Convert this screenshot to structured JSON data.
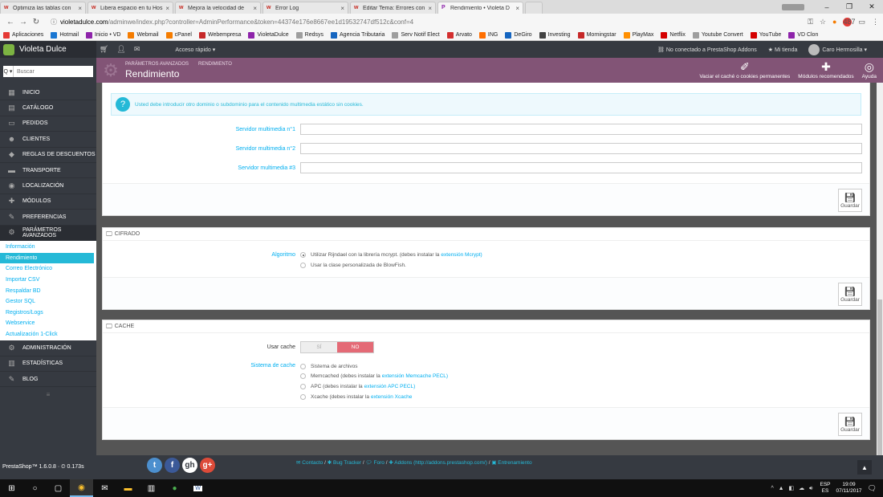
{
  "browser": {
    "tabs": [
      {
        "title": "Optimiza las tablas con",
        "icon": "w",
        "active": false
      },
      {
        "title": "Libera espacio en tu Hos",
        "icon": "w",
        "active": false
      },
      {
        "title": "Mejora la velocidad de",
        "icon": "w",
        "active": false
      },
      {
        "title": "Error Log",
        "icon": "w",
        "active": false
      },
      {
        "title": "Editar Tema: Errores con",
        "icon": "w",
        "active": false
      },
      {
        "title": "Rendimiento • Violeta D",
        "icon": "P",
        "active": true
      }
    ],
    "url_host": "violetadulce.com",
    "url_rest": "/adminwe/index.php?controller=AdminPerformance&token=44374e176e8667ee1d19532747df512c&conf=4",
    "ext_badge": "487",
    "bookmarks": [
      {
        "label": "Aplicaciones",
        "color": "#e53935"
      },
      {
        "label": "Hotmail",
        "color": "#1976d2"
      },
      {
        "label": "Inicio • VD",
        "color": "#8e24aa"
      },
      {
        "label": "Webmail",
        "color": "#f57c00"
      },
      {
        "label": "cPanel",
        "color": "#f57c00"
      },
      {
        "label": "Webempresa",
        "color": "#c62828"
      },
      {
        "label": "VioletaDulce",
        "color": "#8e24aa"
      },
      {
        "label": "Redsys",
        "color": "#9e9e9e"
      },
      {
        "label": "Agencia Tributaria",
        "color": "#1565c0"
      },
      {
        "label": "Serv Notif Elect",
        "color": "#9e9e9e"
      },
      {
        "label": "Arvato",
        "color": "#d32f2f"
      },
      {
        "label": "ING",
        "color": "#ff6f00"
      },
      {
        "label": "DeGiro",
        "color": "#1565c0"
      },
      {
        "label": "Investing",
        "color": "#424242"
      },
      {
        "label": "Morningstar",
        "color": "#c62828"
      },
      {
        "label": "PlayMax",
        "color": "#ff8f00"
      },
      {
        "label": "Netflix",
        "color": "#d50000"
      },
      {
        "label": "Youtube Convert",
        "color": "#9e9e9e"
      },
      {
        "label": "YouTube",
        "color": "#d50000"
      },
      {
        "label": "VD Clon",
        "color": "#8e24aa"
      }
    ]
  },
  "header": {
    "shop_name": "Violeta Dulce",
    "quick_access": "Acceso rápido ▾",
    "not_connected": "No conectado a PrestaShop Addons",
    "my_shop": "Mi tienda",
    "user": "Caro Hermosilla ▾"
  },
  "sidebar": {
    "search_btn": "Q ▾",
    "search_placeholder": "Buscar",
    "items_top": [
      {
        "label": "Inicio",
        "icon": "▦"
      },
      {
        "label": "Catálogo",
        "icon": "▤"
      },
      {
        "label": "Pedidos",
        "icon": "▭"
      },
      {
        "label": "Clientes",
        "icon": "☻"
      },
      {
        "label": "Reglas de descuentos",
        "icon": "◆"
      },
      {
        "label": "Transporte",
        "icon": "▬"
      },
      {
        "label": "Localización",
        "icon": "◉"
      },
      {
        "label": "Módulos",
        "icon": "✚"
      },
      {
        "label": "Preferencias",
        "icon": "✎"
      },
      {
        "label": "Parámetros avanzados",
        "icon": "⚙"
      }
    ],
    "submenu": [
      {
        "label": "Información",
        "active": false
      },
      {
        "label": "Rendimiento",
        "active": true
      },
      {
        "label": "Correo Electrónico",
        "active": false
      },
      {
        "label": "Importar CSV",
        "active": false
      },
      {
        "label": "Respaldar BD",
        "active": false
      },
      {
        "label": "Gestor SQL",
        "active": false
      },
      {
        "label": "Registros/Logs",
        "active": false
      },
      {
        "label": "Webservice",
        "active": false
      },
      {
        "label": "Actualización 1-Click",
        "active": false
      }
    ],
    "items_bottom": [
      {
        "label": "Administración",
        "icon": "⚙"
      },
      {
        "label": "Estadísticas",
        "icon": "▥"
      },
      {
        "label": "Blog",
        "icon": "✎"
      }
    ],
    "collapse": "≡",
    "footer": "PrestaShop™ 1.6.0.8 · ⏲ 0.173s"
  },
  "content_header": {
    "breadcrumb": [
      "Parámetros avanzados",
      "Rendimiento"
    ],
    "title": "Rendimiento",
    "toolbar": [
      {
        "label": "Vaciar el caché o cookies permanentes",
        "icon": "✐"
      },
      {
        "label": "Módulos recomendados",
        "icon": "✚"
      },
      {
        "label": "Ayuda",
        "icon": "◎"
      }
    ]
  },
  "media_panel": {
    "info": "Usted debe introducir otro dominio o subdominio para el contenido multimedia estático sin cookies.",
    "fields": [
      {
        "label": "Servidor multimedia n°1",
        "value": ""
      },
      {
        "label": "Servidor multimedia n°2",
        "value": ""
      },
      {
        "label": "Servidor multimedia #3",
        "value": ""
      }
    ],
    "save": "Guardar"
  },
  "cipher_panel": {
    "heading": "Cifrado",
    "label": "Algoritmo",
    "option1_text": "Utilizar Rijndael con la librería mcrypt. (debes instalar la",
    "option1_link": "extensión Mcrypt)",
    "option2_text": "Usar la clase personalizada de BlowFish.",
    "save": "Guardar"
  },
  "cache_panel": {
    "heading": "Cache",
    "use_cache_label": "Usar cache",
    "switch_yes": "SÍ",
    "switch_no": "NO",
    "system_label": "Sistema de cache",
    "options": [
      {
        "text": "Sistema de archivos",
        "link": ""
      },
      {
        "text": "Memcached (debes instalar la",
        "link": "extensión Memcache PECL)"
      },
      {
        "text": "APC (debes instalar la",
        "link": "extensión APC PECL)"
      },
      {
        "text": "Xcache (debes instalar la",
        "link": "extensión Xcache"
      }
    ],
    "save": "Guardar"
  },
  "footer": {
    "links": [
      "Contacto",
      "Bug Tracker",
      "Foro",
      "Addons (http://addons.prestashop.com/)",
      "Entrenamiento"
    ],
    "social": [
      "t",
      "f",
      "gh",
      "g+"
    ]
  },
  "taskbar": {
    "lang_top": "ESP",
    "lang_bottom": "ES",
    "time": "19:09",
    "date": "07/11/2017"
  }
}
